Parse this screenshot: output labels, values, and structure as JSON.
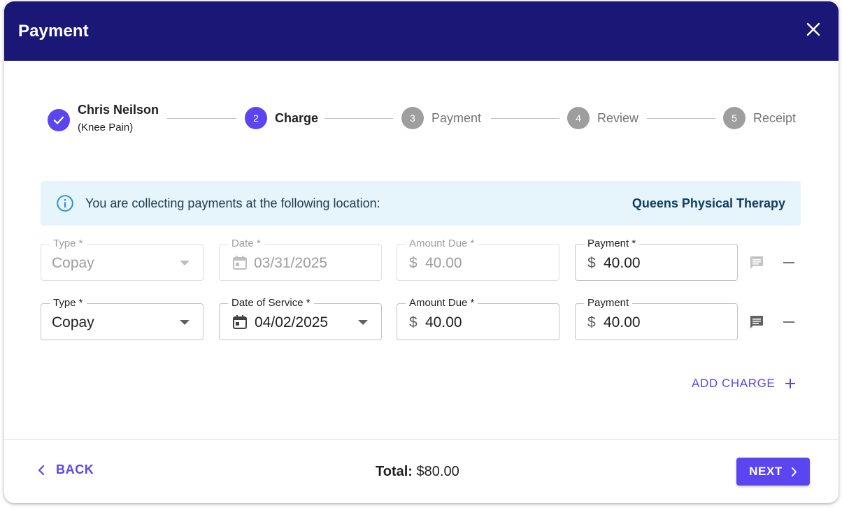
{
  "dialog": {
    "title": "Payment"
  },
  "stepper": {
    "steps": [
      {
        "number": "",
        "label": "Chris Neilson",
        "sublabel": "(Knee Pain)",
        "state": "completed"
      },
      {
        "number": "2",
        "label": "Charge",
        "state": "active"
      },
      {
        "number": "3",
        "label": "Payment",
        "state": "pending"
      },
      {
        "number": "4",
        "label": "Review",
        "state": "pending"
      },
      {
        "number": "5",
        "label": "Receipt",
        "state": "pending"
      }
    ]
  },
  "info_banner": {
    "icon": "info-icon",
    "text": "You are collecting payments at the following location:",
    "location": "Queens Physical Therapy"
  },
  "charges": [
    {
      "disabled": true,
      "type": {
        "label": "Type *",
        "value": "Copay"
      },
      "date": {
        "label": "Date *",
        "value": "03/31/2025"
      },
      "amount_due": {
        "label": "Amount Due *",
        "prefix": "$",
        "value": "40.00"
      },
      "payment": {
        "label": "Payment *",
        "prefix": "$",
        "value": "40.00"
      }
    },
    {
      "disabled": false,
      "type": {
        "label": "Type *",
        "value": "Copay"
      },
      "date": {
        "label": "Date of Service *",
        "value": "04/02/2025"
      },
      "amount_due": {
        "label": "Amount Due *",
        "prefix": "$",
        "value": "40.00"
      },
      "payment": {
        "label": "Payment",
        "prefix": "$",
        "value": "40.00"
      }
    }
  ],
  "actions": {
    "add_charge": "ADD CHARGE",
    "back": "BACK",
    "next": "NEXT"
  },
  "total": {
    "label": "Total:",
    "value": "$80.00"
  },
  "colors": {
    "header": "#1a1776",
    "primary": "#5a45f0",
    "info_bg": "#e6f4fb",
    "pending_step": "#9e9e9e"
  }
}
